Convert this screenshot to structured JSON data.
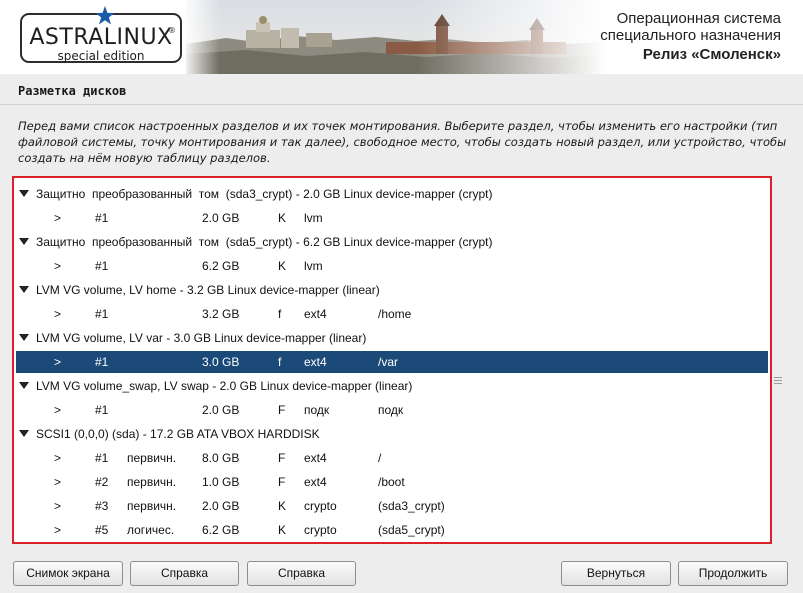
{
  "banner": {
    "logo_title": "ASTRALINUX",
    "logo_reg": "®",
    "logo_subtitle": "special edition",
    "os_line1": "Операционная система",
    "os_line2": "специального назначения",
    "release": "Релиз «Смоленск»"
  },
  "page_title": "Разметка дисков",
  "instructions": "Перед вами список настроенных разделов и их точек монтирования. Выберите раздел, чтобы изменить его настройки (тип файловой системы, точку монтирования и так далее), свободное место, чтобы создать новый раздел, или устройство, чтобы создать на нём новую таблицу разделов.",
  "partitions": [
    {
      "kind": "group",
      "text": "Защитно  преобразованный  том  (sda3_crypt) - 2.0 GB Linux device-mapper (crypt)"
    },
    {
      "kind": "part",
      "arrow": ">",
      "num": "#1",
      "type": "",
      "size": "2.0 GB",
      "flag": "K",
      "fs": "lvm",
      "mount": ""
    },
    {
      "kind": "group",
      "text": "Защитно  преобразованный  том  (sda5_crypt) - 6.2 GB Linux device-mapper (crypt)"
    },
    {
      "kind": "part",
      "arrow": ">",
      "num": "#1",
      "type": "",
      "size": "6.2 GB",
      "flag": "K",
      "fs": "lvm",
      "mount": ""
    },
    {
      "kind": "group",
      "text": "LVM VG volume, LV home - 3.2 GB Linux device-mapper (linear)"
    },
    {
      "kind": "part",
      "arrow": ">",
      "num": "#1",
      "type": "",
      "size": "3.2 GB",
      "flag": "f",
      "fs": "ext4",
      "mount": "/home"
    },
    {
      "kind": "group",
      "text": "LVM VG volume, LV var - 3.0 GB Linux device-mapper (linear)"
    },
    {
      "kind": "part",
      "arrow": ">",
      "num": "#1",
      "type": "",
      "size": "3.0 GB",
      "flag": "f",
      "fs": "ext4",
      "mount": "/var",
      "selected": true
    },
    {
      "kind": "group",
      "text": "LVM VG volume_swap, LV swap - 2.0 GB Linux device-mapper (linear)"
    },
    {
      "kind": "part",
      "arrow": ">",
      "num": "#1",
      "type": "",
      "size": "2.0 GB",
      "flag": "F",
      "fs": "подк",
      "mount": "подк"
    },
    {
      "kind": "group",
      "text": "SCSI1 (0,0,0) (sda) - 17.2 GB ATA VBOX HARDDISK"
    },
    {
      "kind": "part",
      "arrow": ">",
      "num": "#1",
      "type": "первичн.",
      "size": "8.0 GB",
      "flag": "F",
      "fs": "ext4",
      "mount": "/"
    },
    {
      "kind": "part",
      "arrow": ">",
      "num": "#2",
      "type": "первичн.",
      "size": "1.0 GB",
      "flag": "F",
      "fs": "ext4",
      "mount": "/boot"
    },
    {
      "kind": "part",
      "arrow": ">",
      "num": "#3",
      "type": "первичн.",
      "size": "2.0 GB",
      "flag": "K",
      "fs": "crypto",
      "mount": "(sda3_crypt)"
    },
    {
      "kind": "part",
      "arrow": ">",
      "num": "#5",
      "type": "логичес.",
      "size": "6.2 GB",
      "flag": "K",
      "fs": "crypto",
      "mount": "(sda5_crypt)"
    }
  ],
  "buttons": {
    "screenshot": "Снимок экрана",
    "help1": "Справка",
    "help2": "Справка",
    "back": "Вернуться",
    "continue": "Продолжить"
  },
  "colors": {
    "selected_row": "#1c4a78",
    "frame": "#d8212a",
    "star": "#1b5aa6"
  }
}
